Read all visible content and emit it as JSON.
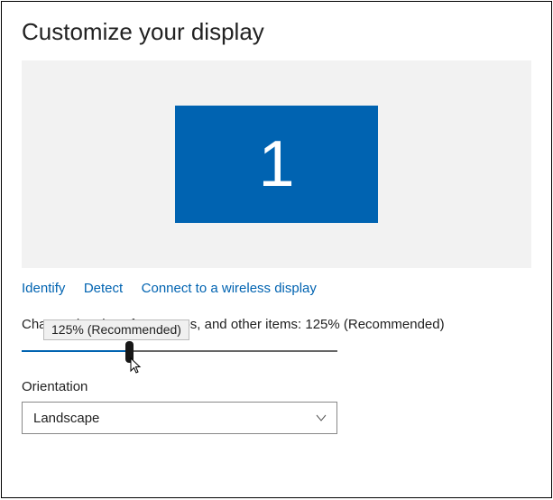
{
  "title": "Customize your display",
  "monitor": {
    "number": "1"
  },
  "links": {
    "identify": "Identify",
    "detect": "Detect",
    "wireless": "Connect to a wireless display"
  },
  "tooltip": "125% (Recommended)",
  "scale": {
    "label": "Change the size of text, apps, and other items: 125% (Recommended)"
  },
  "orientation": {
    "label": "Orientation",
    "selected": "Landscape"
  },
  "colors": {
    "accent": "#0063b1",
    "panel": "#f2f2f2"
  }
}
